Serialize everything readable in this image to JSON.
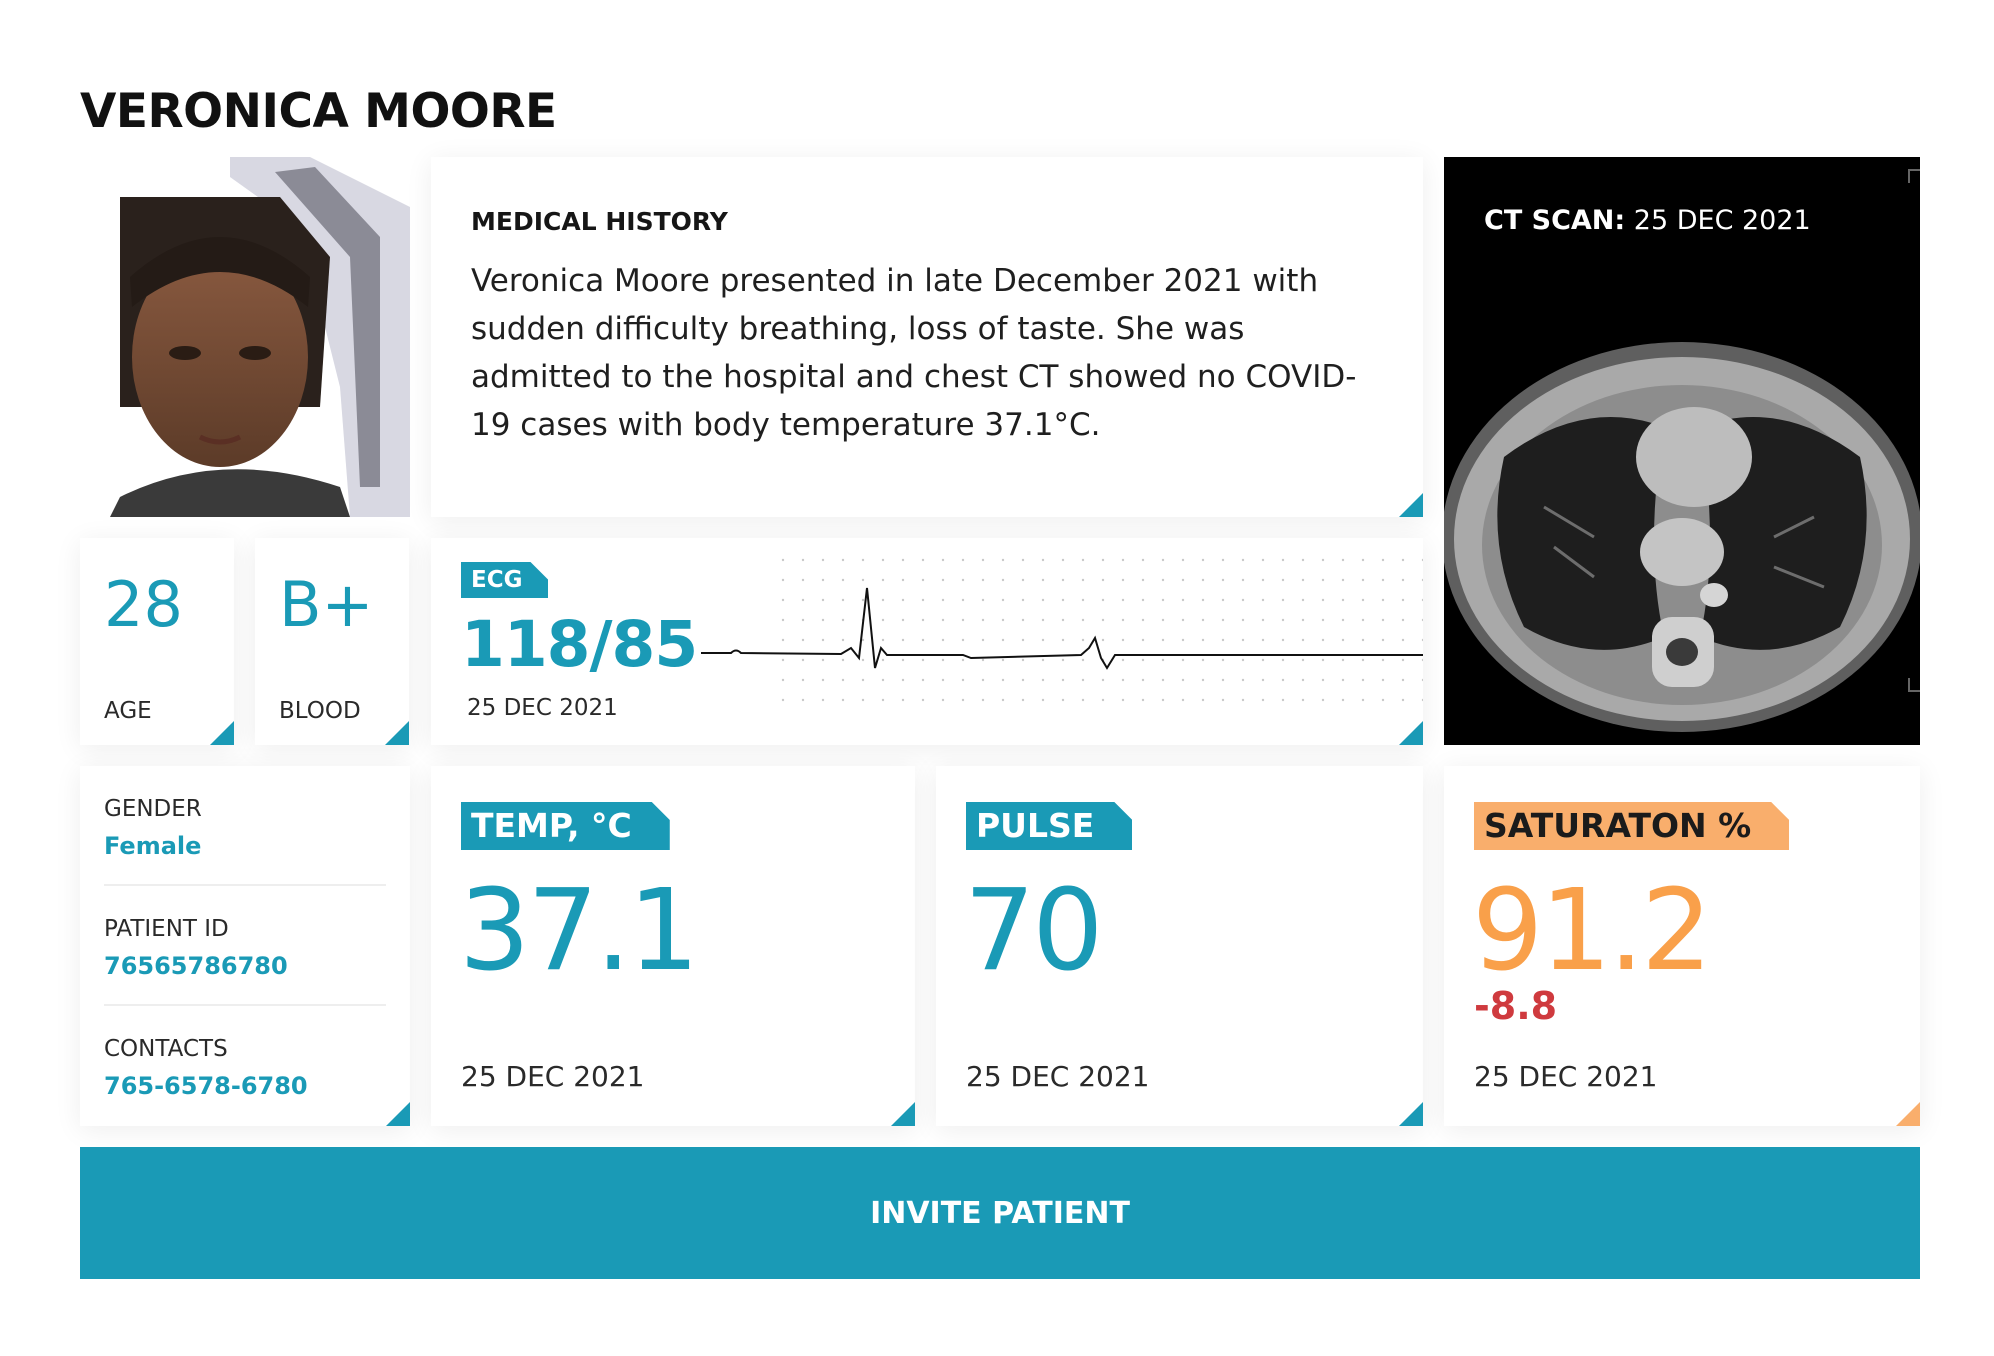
{
  "patient": {
    "name": "VERONICA MOORE"
  },
  "medical_history": {
    "label": "MEDICAL HISTORY",
    "text": "Veronica Moore presented in late December 2021 with sudden difficulty breathing, loss of taste. She was admitted to the hospital and chest CT showed no COVID-19 cases with body temperature 37.1°C."
  },
  "ct_scan": {
    "label": "CT SCAN:",
    "date": "25 DEC 2021"
  },
  "stats": {
    "age": {
      "value": "28",
      "label": "AGE"
    },
    "blood": {
      "value": "B+",
      "label": "BLOOD"
    }
  },
  "ecg": {
    "label": "ECG",
    "value": "118/85",
    "date": "25 DEC 2021"
  },
  "info": {
    "gender": {
      "label": "GENDER",
      "value": "Female"
    },
    "patient_id": {
      "label": "PATIENT ID",
      "value": "76565786780"
    },
    "contacts": {
      "label": "CONTACTS",
      "value": "765-6578-6780"
    }
  },
  "vitals": {
    "temp": {
      "label": "TEMP, °C",
      "value": "37.1",
      "date": "25 DEC 2021"
    },
    "pulse": {
      "label": "PULSE",
      "value": "70",
      "date": "25 DEC 2021"
    },
    "saturation": {
      "label": "SATURATON %",
      "value": "91.2",
      "delta": "-8.8",
      "date": "25 DEC 2021"
    }
  },
  "actions": {
    "invite_label": "INVITE PATIENT"
  },
  "colors": {
    "accent": "#1a9ab6",
    "warning": "#f9ae6c",
    "warning_value": "#f9a04a",
    "negative": "#cf3a3e",
    "ct_background": "#000000"
  },
  "icons": {
    "corner_marker": "corner-triangle-icon"
  }
}
